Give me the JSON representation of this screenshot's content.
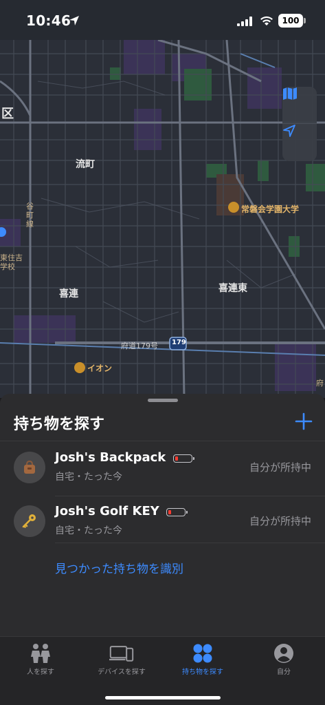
{
  "status_bar": {
    "time": "10:46",
    "battery": "100"
  },
  "map": {
    "labels": {
      "ku": "区",
      "nagaremachi": "流町",
      "kitsure": "喜連",
      "kitsure_higashi": "喜連東",
      "tanimachi_line": "谷町線",
      "higashisumiyoshi_school": "東住吉学校",
      "university": "常磐会学園大学",
      "route": "府道179号",
      "route_shield": "179",
      "aeon": "イオン",
      "edge_text": "府"
    },
    "colors": {
      "background": "#2b2f38",
      "road": "#4a505c",
      "major_road": "#6b7280",
      "park": "#2f5a3f",
      "purple_zone": "#3b3357"
    }
  },
  "sheet": {
    "title": "持ち物を探す",
    "add_icon": "plus-icon",
    "items": [
      {
        "name": "Josh's Backpack",
        "subtitle": "自宅・たった今",
        "status": "自分が所持中",
        "icon": "backpack-icon",
        "battery_level": "low"
      },
      {
        "name": "Josh's Golf KEY",
        "subtitle": "自宅・たった今",
        "status": "自分が所持中",
        "icon": "key-icon",
        "battery_level": "low"
      }
    ],
    "identify_link": "見つかった持ち物を識別"
  },
  "tabbar": {
    "tabs": [
      {
        "label": "人を探す",
        "icon": "people-icon",
        "active": false
      },
      {
        "label": "デバイスを探す",
        "icon": "devices-icon",
        "active": false
      },
      {
        "label": "持ち物を探す",
        "icon": "items-icon",
        "active": true
      },
      {
        "label": "自分",
        "icon": "person-icon",
        "active": false
      }
    ],
    "accent": "#3d8bff"
  }
}
